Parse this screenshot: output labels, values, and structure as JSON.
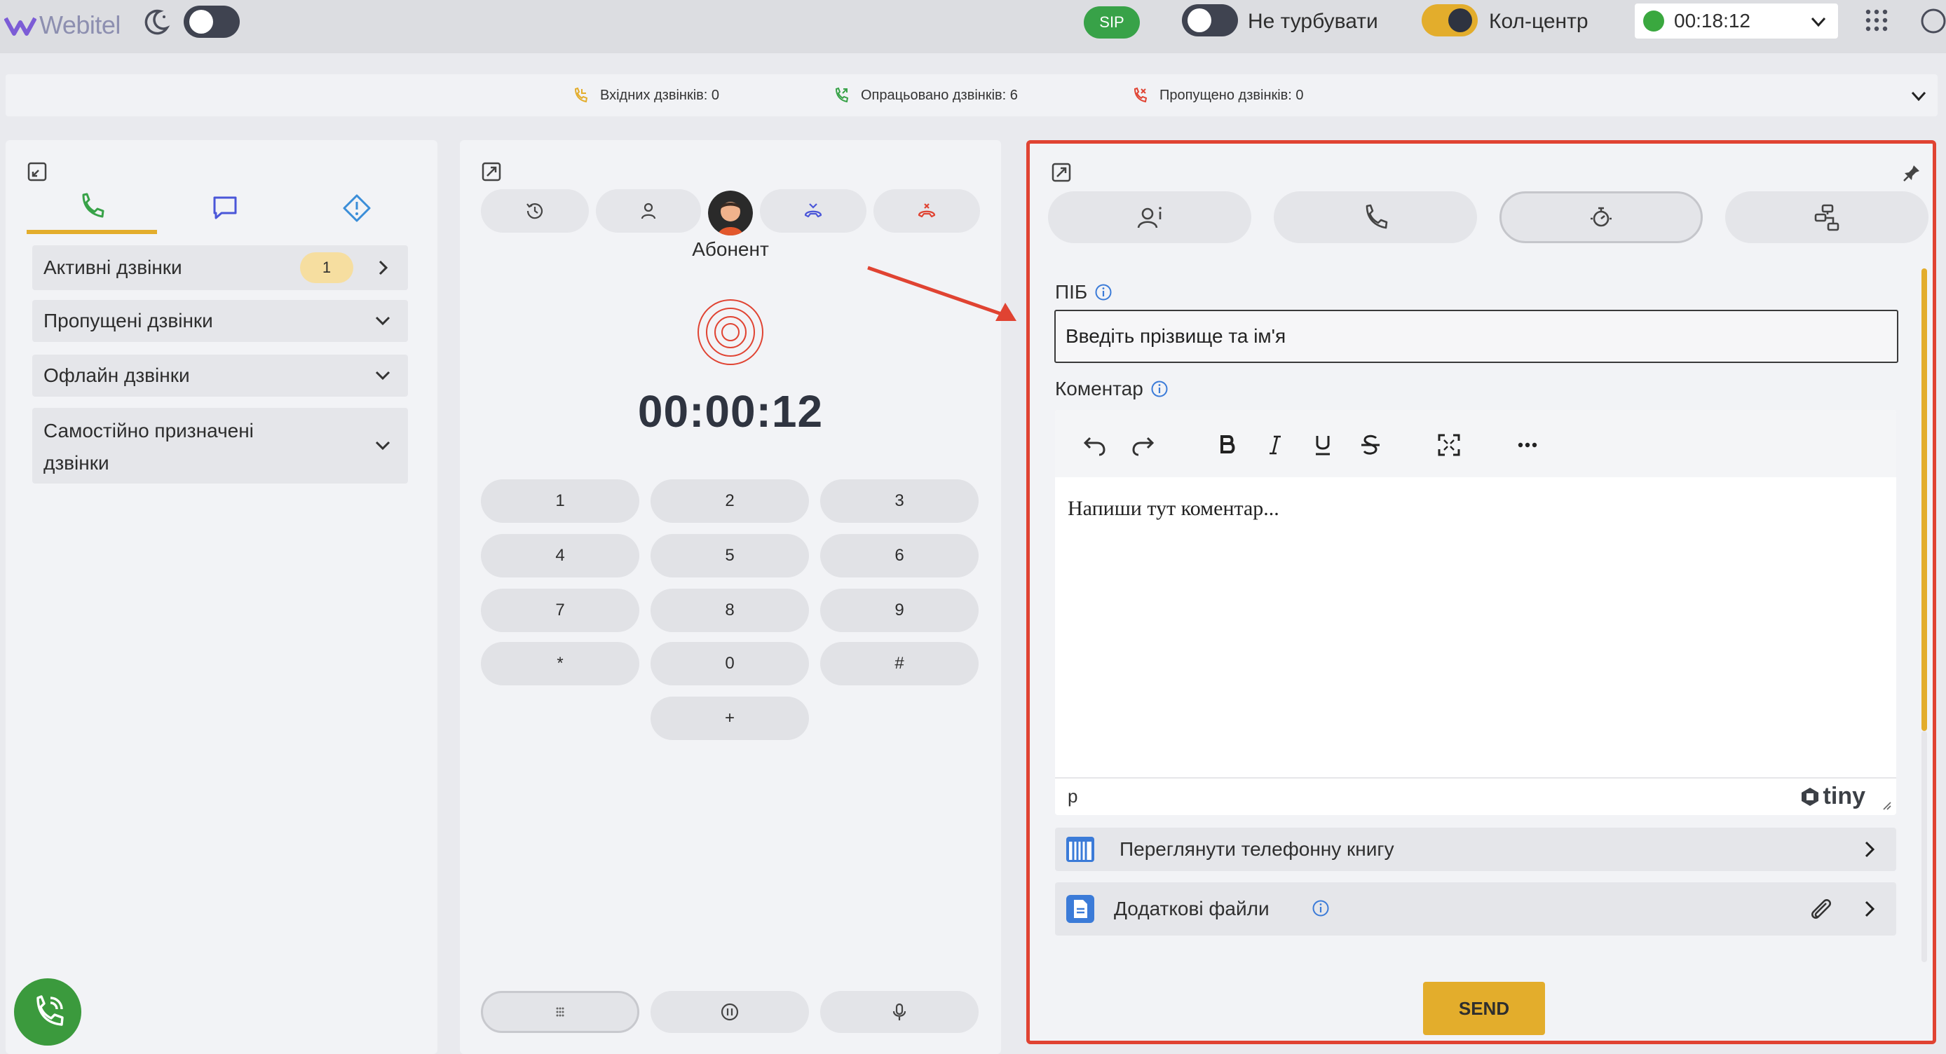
{
  "topbar": {
    "brand": "Webitel",
    "sip_label": "SIP",
    "dnd_label": "Не турбувати",
    "callcenter_label": "Кол-центр",
    "session_timer": "00:18:12",
    "status_color": "#3aa83f",
    "icons": [
      "moon-icon",
      "apps-grid-icon",
      "chevron-down-icon"
    ]
  },
  "stats": {
    "incoming": "Вхідних дзвінків: 0",
    "processed": "Опрацьовано дзвінків: 6",
    "missed": "Пропущено дзвінків: 0"
  },
  "left_panel": {
    "tabs": [
      "phone-icon",
      "chat-icon",
      "alert-icon"
    ],
    "active_tab": "phone",
    "items": [
      {
        "label": "Активні дзвінки",
        "count": "1"
      },
      {
        "label": "Пропущені дзвінки"
      },
      {
        "label": "Офлайн дзвінки"
      },
      {
        "label_line1": "Самостійно призначені",
        "label_line2": "дзвінки"
      }
    ]
  },
  "middle_panel": {
    "subscriber": "Абонент",
    "call_timer": "00:00:12",
    "keypad": [
      "1",
      "2",
      "3",
      "4",
      "5",
      "6",
      "7",
      "8",
      "9",
      "*",
      "0",
      "#",
      "+"
    ],
    "tab_icons": [
      "history-icon",
      "contact-icon",
      "avatar",
      "transfer-icon",
      "hangup-icon"
    ],
    "bottom_controls": [
      "dialpad-icon",
      "hold-icon",
      "mic-icon"
    ]
  },
  "right_panel": {
    "tabs": [
      "client-info-icon",
      "phone-icon",
      "timer-icon",
      "flow-icon"
    ],
    "active_tab": 2,
    "name_label": "ПІБ",
    "name_placeholder": "Введіть прізвище та ім'я",
    "comment_label": "Коментар",
    "editor_text": "Напиши тут коментар...",
    "editor_path": "p",
    "editor_brand": "tiny",
    "phonebook_label": "Переглянути телефонну книгу",
    "files_label": "Додаткові файли",
    "send_label": "SEND",
    "accent_color": "#e3ad2c",
    "highlight_color": "#e04332"
  }
}
